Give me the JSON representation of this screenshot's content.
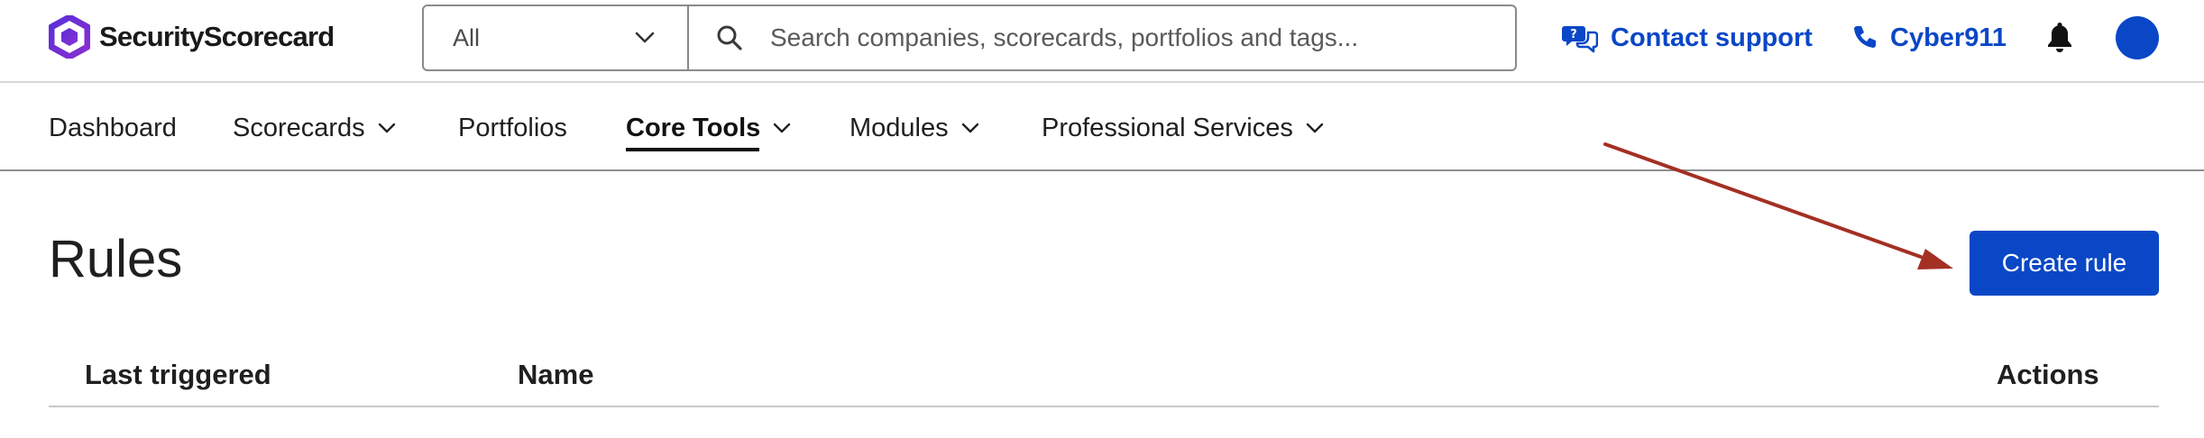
{
  "brand": {
    "name": "SecurityScorecard",
    "accent": "#0a47c6",
    "logo_gradient": [
      "#5b2fd8",
      "#8b2fd0"
    ]
  },
  "header": {
    "search": {
      "scope_selected": "All",
      "placeholder": "Search companies, scorecards, portfolios and tags...",
      "value": ""
    },
    "contact_support": {
      "label": "Contact support",
      "icon": "chat-bubbles-icon"
    },
    "cyber911": {
      "label": "Cyber911",
      "icon": "phone-icon"
    },
    "notifications_icon": "bell-icon",
    "avatar_color": "#0a47c6"
  },
  "nav": {
    "items": [
      {
        "label": "Dashboard",
        "has_dropdown": false,
        "active": false
      },
      {
        "label": "Scorecards",
        "has_dropdown": true,
        "active": false
      },
      {
        "label": "Portfolios",
        "has_dropdown": false,
        "active": false
      },
      {
        "label": "Core Tools",
        "has_dropdown": true,
        "active": true
      },
      {
        "label": "Modules",
        "has_dropdown": true,
        "active": false
      },
      {
        "label": "Professional Services",
        "has_dropdown": true,
        "active": false
      }
    ]
  },
  "main": {
    "title": "Rules",
    "create_button": "Create rule",
    "annotation_arrow_color": "#a33023",
    "table": {
      "columns": [
        "Last triggered",
        "Name",
        "Actions"
      ],
      "rows": []
    }
  }
}
